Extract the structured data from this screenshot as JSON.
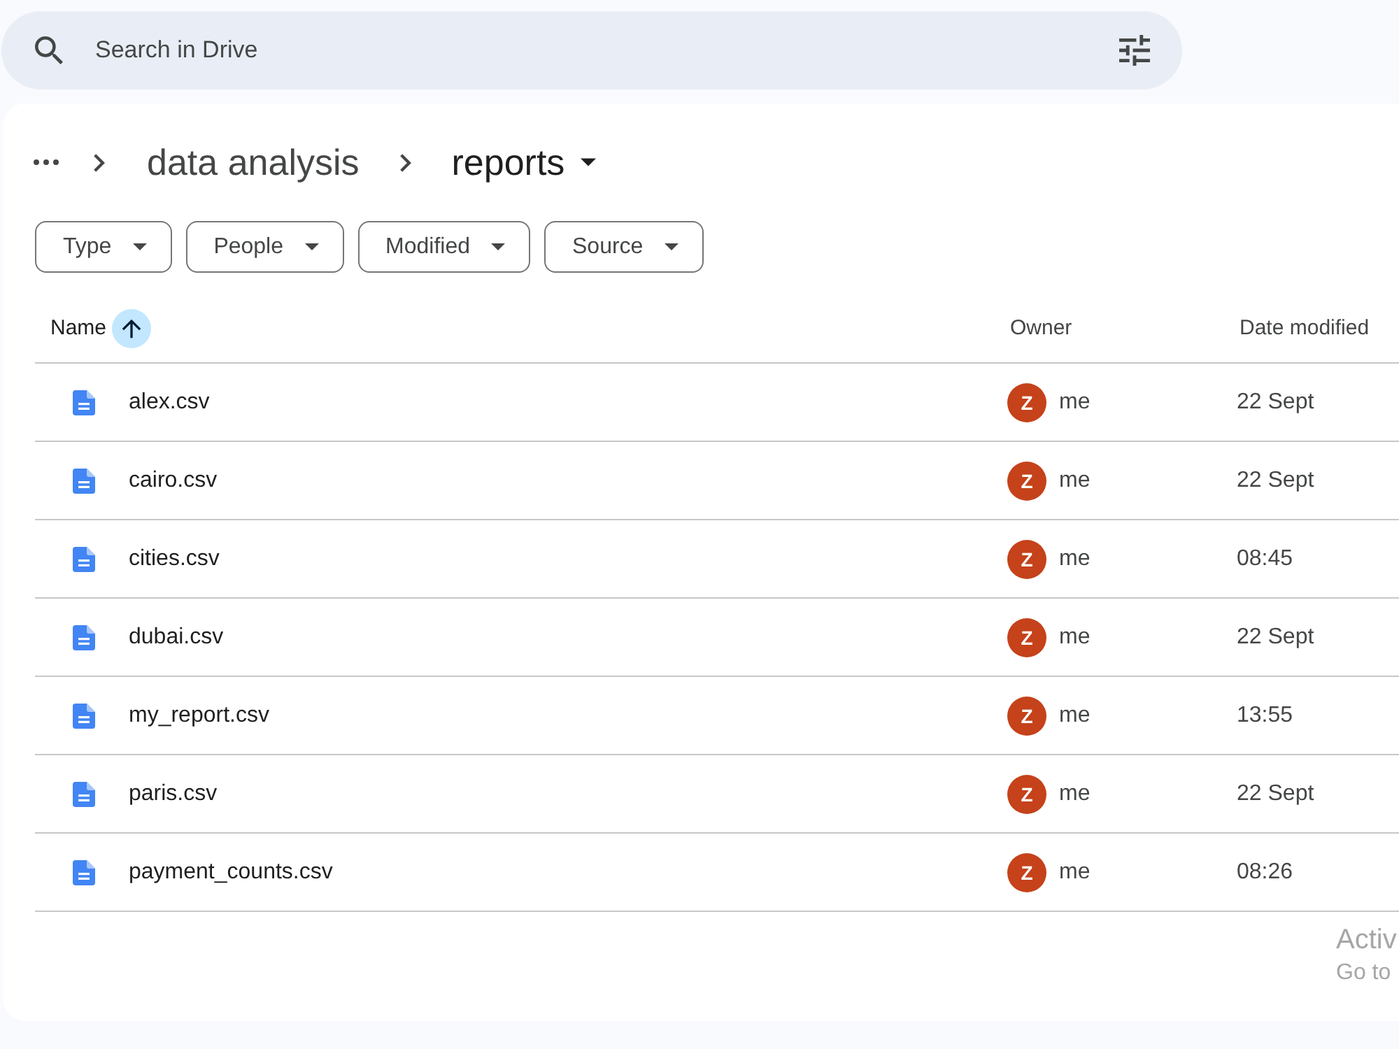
{
  "search": {
    "placeholder": "Search in Drive"
  },
  "breadcrumbs": [
    {
      "label": "data analysis",
      "current": false
    },
    {
      "label": "reports",
      "current": true
    }
  ],
  "filters": [
    {
      "label": "Type"
    },
    {
      "label": "People"
    },
    {
      "label": "Modified"
    },
    {
      "label": "Source"
    }
  ],
  "table": {
    "columns": [
      {
        "label": "Name",
        "sorted": true,
        "ascending": true
      },
      {
        "label": "Owner",
        "sorted": false
      },
      {
        "label": "Date modified",
        "sorted": false
      }
    ],
    "rows": [
      {
        "name": "alex.csv",
        "owner_initial": "Z",
        "owner": "me",
        "modified": "22 Sept"
      },
      {
        "name": "cairo.csv",
        "owner_initial": "Z",
        "owner": "me",
        "modified": "22 Sept"
      },
      {
        "name": "cities.csv",
        "owner_initial": "Z",
        "owner": "me",
        "modified": "08:45"
      },
      {
        "name": "dubai.csv",
        "owner_initial": "Z",
        "owner": "me",
        "modified": "22 Sept"
      },
      {
        "name": "my_report.csv",
        "owner_initial": "Z",
        "owner": "me",
        "modified": "13:55"
      },
      {
        "name": "paris.csv",
        "owner_initial": "Z",
        "owner": "me",
        "modified": "22 Sept"
      },
      {
        "name": "payment_counts.csv",
        "owner_initial": "Z",
        "owner": "me",
        "modified": "08:26"
      }
    ]
  },
  "activation_notice": {
    "title": "Activ",
    "text": "Go to"
  }
}
